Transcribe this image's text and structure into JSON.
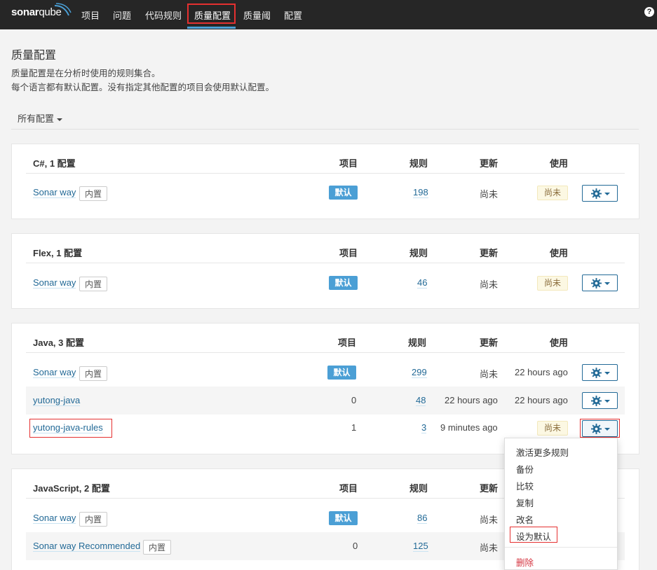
{
  "topbar": {
    "logo_sonar": "sonar",
    "logo_qube": "qube",
    "nav": [
      "项目",
      "问题",
      "代码规则",
      "质量配置",
      "质量阈",
      "配置"
    ],
    "active_nav": "质量配置",
    "help_icon": "?"
  },
  "page": {
    "title": "质量配置",
    "desc_line1": "质量配置是在分析时使用的规则集合。",
    "desc_line2": "每个语言都有默认配置。没有指定其他配置的项目会使用默认配置。",
    "filter_label": "所有配置"
  },
  "columns": {
    "projects": "项目",
    "rules": "规则",
    "updated": "更新",
    "used": "使用"
  },
  "languages": [
    {
      "title": "C#, 1 配置",
      "profiles": [
        {
          "name": "Sonar way",
          "builtin": "内置",
          "projects": "默认",
          "rules": "198",
          "updated": "尚未",
          "used": "尚未"
        }
      ]
    },
    {
      "title": "Flex, 1 配置",
      "profiles": [
        {
          "name": "Sonar way",
          "builtin": "内置",
          "projects": "默认",
          "rules": "46",
          "updated": "尚未",
          "used": "尚未"
        }
      ]
    },
    {
      "title": "Java, 3 配置",
      "profiles": [
        {
          "name": "Sonar way",
          "builtin": "内置",
          "projects": "默认",
          "rules": "299",
          "updated": "尚未",
          "used": "22 hours ago"
        },
        {
          "name": "yutong-java",
          "builtin": "",
          "projects": "0",
          "rules": "48",
          "updated": "22 hours ago",
          "used": "22 hours ago"
        },
        {
          "name": "yutong-java-rules",
          "builtin": "",
          "projects": "1",
          "rules": "3",
          "updated": "9 minutes ago",
          "used": "尚未"
        }
      ]
    },
    {
      "title": "JavaScript, 2 配置",
      "profiles": [
        {
          "name": "Sonar way",
          "builtin": "内置",
          "projects": "默认",
          "rules": "86",
          "updated": "尚未",
          "used": ""
        },
        {
          "name": "Sonar way Recommended",
          "builtin": "内置",
          "projects": "0",
          "rules": "125",
          "updated": "尚未",
          "used": ""
        }
      ]
    }
  ],
  "dropdown": {
    "items": [
      "激活更多规则",
      "备份",
      "比较",
      "复制",
      "改名",
      "设为默认"
    ],
    "delete": "删除"
  },
  "colors": {
    "topbar": "#262626",
    "accent": "#4b9fd5",
    "link": "#236a97",
    "highlight_box": "#e53030",
    "delete": "#d4333f"
  }
}
